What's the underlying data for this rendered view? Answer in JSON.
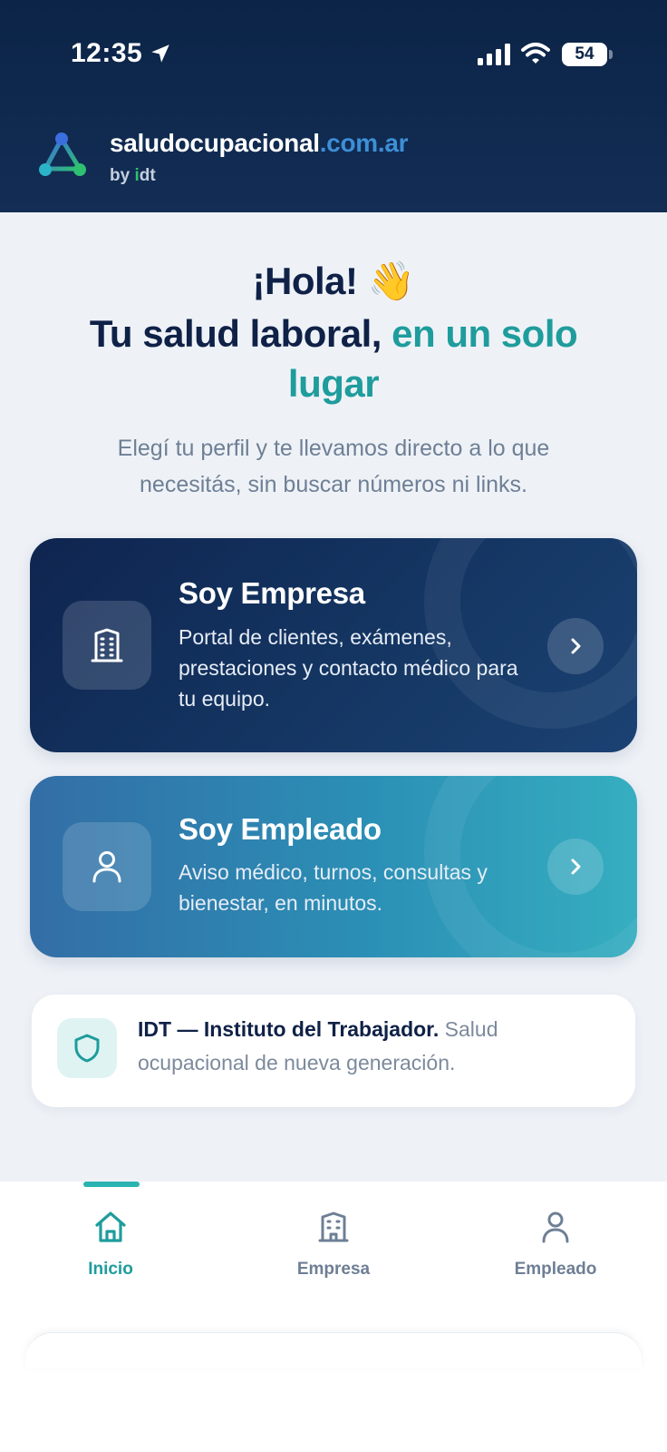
{
  "status_bar": {
    "time": "12:35",
    "battery": "54",
    "battery_level": 0.54
  },
  "brand": {
    "name": "saludocupacional",
    "domain": ".com.ar",
    "by": "by ",
    "by_i": "i",
    "by_dt": "dt"
  },
  "hero": {
    "greeting": "¡Hola! 👋",
    "headline_main": "Tu salud laboral, ",
    "headline_accent": "en un solo lugar",
    "subtitle": "Elegí tu perfil y te llevamos directo a lo que necesitás, sin buscar números ni links."
  },
  "cards": {
    "empresa": {
      "title": "Soy Empresa",
      "description": "Portal de clientes, exámenes, prestaciones y contacto médico para tu equipo.",
      "icon": "building-icon"
    },
    "empleado": {
      "title": "Soy Empleado",
      "description": "Aviso médico, turnos, consultas y bienestar, en minutos.",
      "icon": "user-icon"
    }
  },
  "info": {
    "strong": "IDT — Instituto del Trabajador.",
    "text": " Salud ocupacional de nueva generación.",
    "icon": "shield-icon"
  },
  "tabbar": {
    "inicio": "Inicio",
    "empresa": "Empresa",
    "empleado": "Empleado"
  },
  "colors": {
    "navy": "#0f2147",
    "teal": "#1f9c9c",
    "accent_blue": "#3d8fd6",
    "background": "#eef2f7"
  }
}
